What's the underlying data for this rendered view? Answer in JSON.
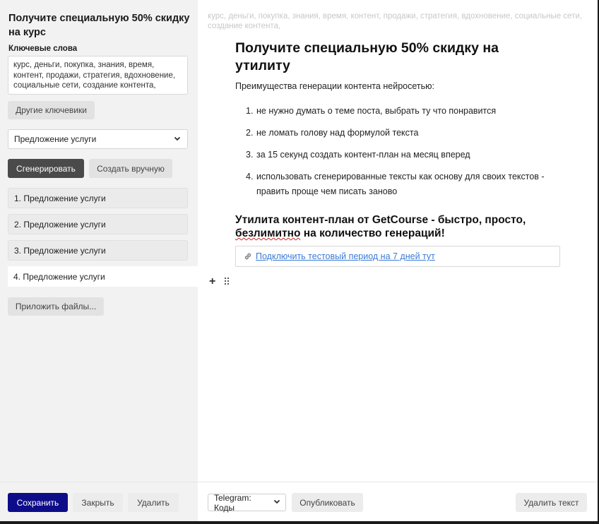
{
  "sidebar": {
    "title": "Получите специальную 50% скидку на курс",
    "keywords_label": "Ключевые слова",
    "keywords_value": "курс, деньги, покупка, знания, время, контент, продажи, стратегия, вдохновение, социальные сети, создание контента,",
    "other_keywords_button": "Другие ключевики",
    "type_select_value": "Предложение услуги",
    "generate_button": "Сгенерировать",
    "create_manual_button": "Создать вручную",
    "variants": [
      "1. Предложение услуги",
      "2. Предложение услуги",
      "3. Предложение услуги",
      "4. Предложение услуги"
    ],
    "attach_files_button": "Приложить файлы..."
  },
  "editor": {
    "keywords_ghost": "курс, деньги, покупка, знания, время, контент, продажи, стратегия, вдохновение, социальные сети, создание контента,",
    "heading": "Получите специальную 50% скидку на утилиту",
    "intro": "Преимущества генерации контента нейросетью:",
    "list": [
      {
        "num": "1.",
        "text": "не нужно думать о теме поста, выбрать ту что понравится"
      },
      {
        "num": "2.",
        "text": "не ломать голову над формулой текста"
      },
      {
        "num": "3.",
        "text": "за 15 секунд создать контент-план на месяц вперед"
      },
      {
        "num": "4.",
        "text": "использовать сгенерированные тексты как основу для своих текстов - править проще чем писать заново"
      }
    ],
    "subheading_part1": "Утилита контент-план от GetCourse - быстро, просто, ",
    "subheading_part2": "безлимитно",
    "subheading_part3": " на количество генераций!",
    "link_text": "Подключить тестовый период на 7 дней тут",
    "add_block_symbol": "+"
  },
  "footer": {
    "save_button": "Сохранить",
    "close_button": "Закрыть",
    "delete_button": "Удалить",
    "channel_select_value": "Telegram: Коды",
    "publish_button": "Опубликовать",
    "delete_text_button": "Удалить текст"
  },
  "colors": {
    "primary": "#0d0d8a",
    "dark_button": "#4a4a4a",
    "link": "#3a7bd5",
    "sidebar_bg": "#f2f2f2"
  },
  "icons": {
    "select_chevron": "chevron-down-icon",
    "link": "link-icon",
    "add": "plus-icon",
    "drag": "drag-handle-icon"
  }
}
